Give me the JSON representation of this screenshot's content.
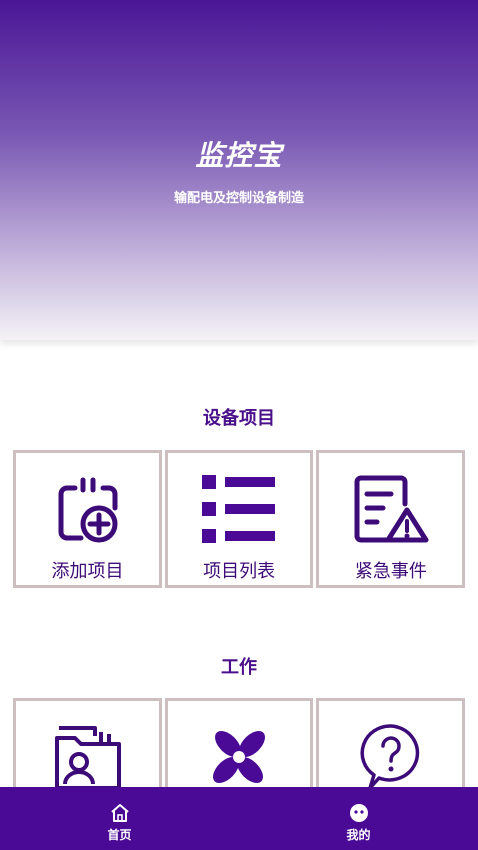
{
  "header": {
    "title": "监控宝",
    "subtitle": "输配电及控制设备制造"
  },
  "sections": [
    {
      "title": "设备项目",
      "items": [
        {
          "label": "添加项目",
          "icon": "add-project-icon"
        },
        {
          "label": "项目列表",
          "icon": "list-icon"
        },
        {
          "label": "紧急事件",
          "icon": "emergency-document-icon"
        }
      ]
    },
    {
      "title": "工作",
      "items": [
        {
          "label": "",
          "icon": "contact-folder-icon"
        },
        {
          "label": "",
          "icon": "fan-icon"
        },
        {
          "label": "",
          "icon": "help-bubble-icon"
        }
      ]
    }
  ],
  "tabbar": {
    "items": [
      {
        "label": "首页",
        "icon": "home-icon"
      },
      {
        "label": "我的",
        "icon": "profile-face-icon"
      }
    ]
  },
  "colors": {
    "primary": "#4a0a96",
    "card_border": "#cdbfbf",
    "text_primary": "#3d0b78"
  }
}
